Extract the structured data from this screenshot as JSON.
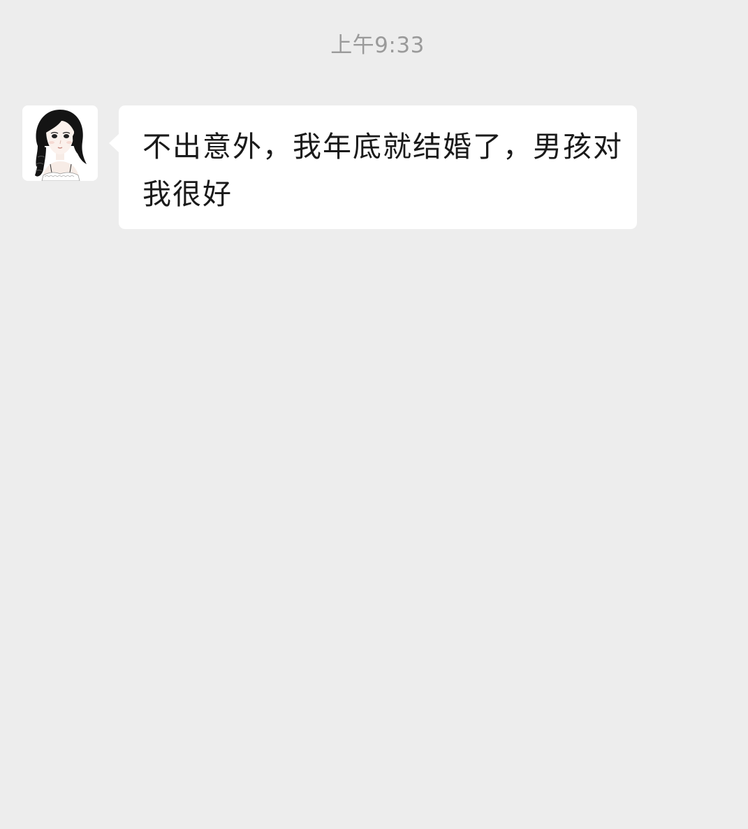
{
  "chat": {
    "timestamp": "上午9:33",
    "messages": [
      {
        "sender": "contact",
        "avatar": "girl-illustration-avatar",
        "text": "不出意外，我年底就结婚了，男孩对我很好"
      }
    ]
  },
  "colors": {
    "background": "#ededed",
    "bubble": "#ffffff",
    "text": "#1a1a1a",
    "timestamp": "#9a9a9a"
  }
}
